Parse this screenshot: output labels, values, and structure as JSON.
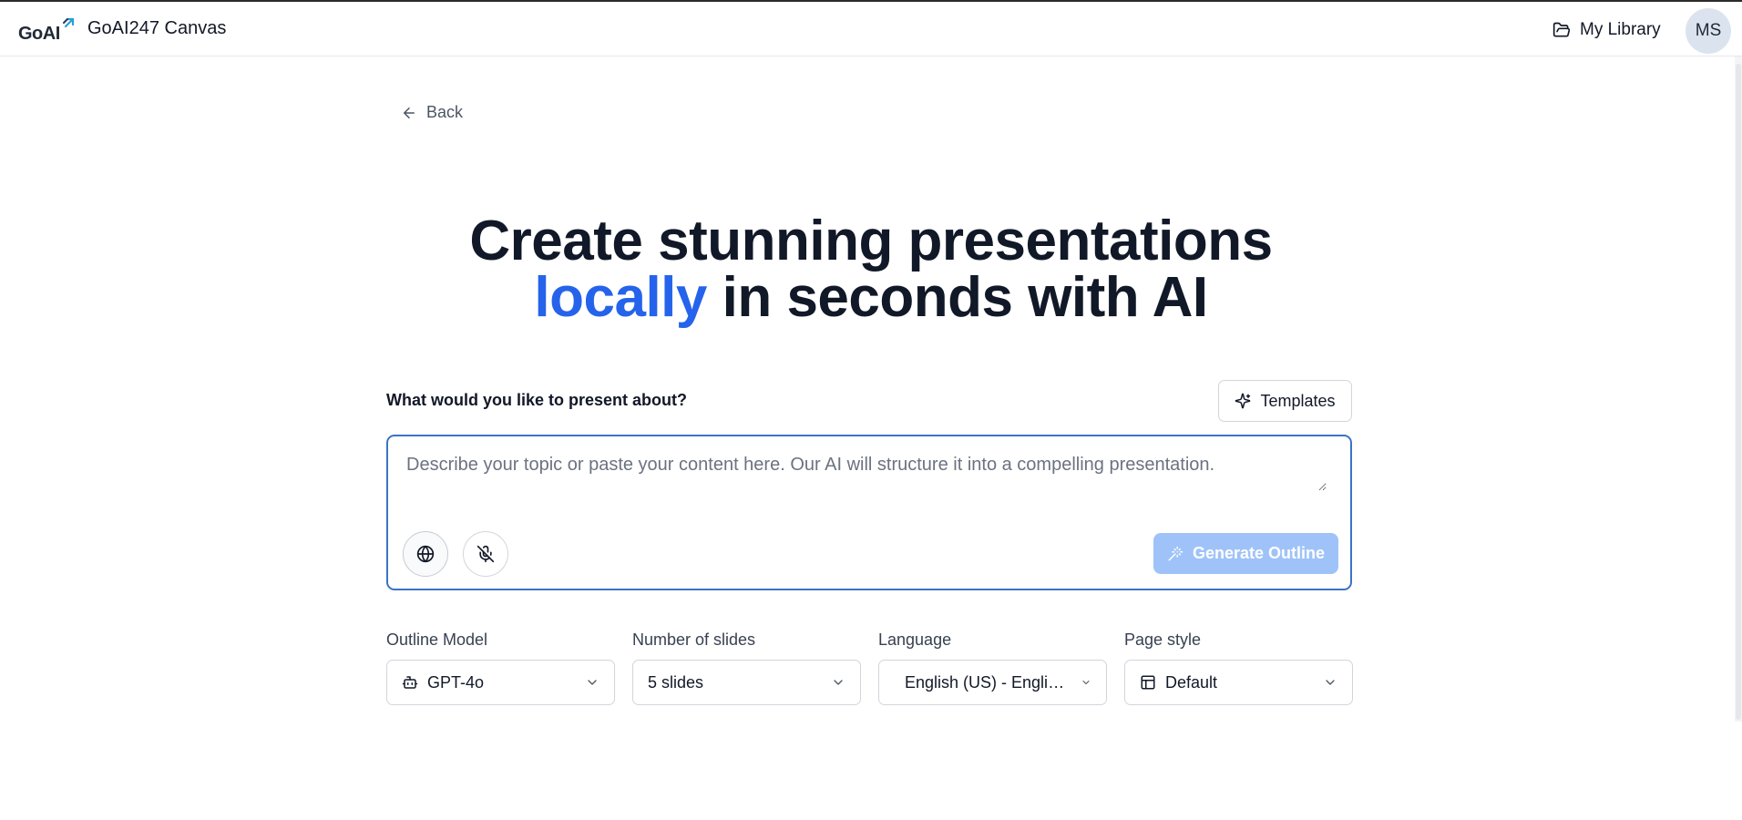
{
  "header": {
    "logo_text": "GoAI",
    "app_title": "GoAI247 Canvas",
    "library_label": "My Library",
    "avatar_initials": "MS"
  },
  "nav": {
    "back_label": "Back"
  },
  "hero": {
    "line1": "Create stunning presentations",
    "accent": "locally",
    "line2_rest": " in seconds with AI",
    "accent_color": "#2563eb"
  },
  "prompt": {
    "label": "What would you like to present about?",
    "templates_label": "Templates",
    "placeholder": "Describe your topic or paste your content here. Our AI will structure it into a compelling presentation.",
    "value": "",
    "generate_label": "Generate Outline"
  },
  "options": {
    "outline_model": {
      "label": "Outline Model",
      "value": "GPT-4o",
      "icon": "bot-icon"
    },
    "slides": {
      "label": "Number of slides",
      "value": "5 slides"
    },
    "language": {
      "label": "Language",
      "value": "English (US) - English..."
    },
    "page_style": {
      "label": "Page style",
      "value": "Default",
      "icon": "layout-icon"
    }
  },
  "colors": {
    "focus_border": "#3b74c4",
    "generate_disabled_bg": "#9fc3f8",
    "avatar_bg": "#dbe4ee"
  }
}
